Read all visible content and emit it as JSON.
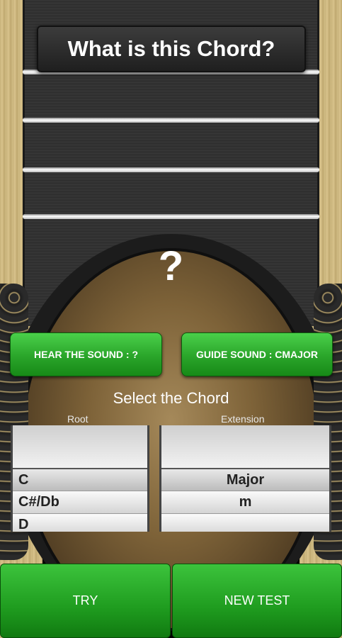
{
  "header": {
    "title": "What is this Chord?"
  },
  "question_mark": "?",
  "buttons": {
    "hear_sound": "HEAR THE SOUND : ?",
    "guide_sound": "GUIDE SOUND : CMAJOR",
    "try": "TRY",
    "new_test": "NEW TEST"
  },
  "selector": {
    "title": "Select the Chord",
    "root_label": "Root",
    "extension_label": "Extension",
    "root_options": [
      "C",
      "C#/Db",
      "D"
    ],
    "extension_options": [
      "Major",
      "m"
    ],
    "selected_root": "C",
    "selected_extension": "Major"
  },
  "colors": {
    "button_green": "#2aa52a",
    "neck": "#333333",
    "wood": "#c8b27a"
  }
}
